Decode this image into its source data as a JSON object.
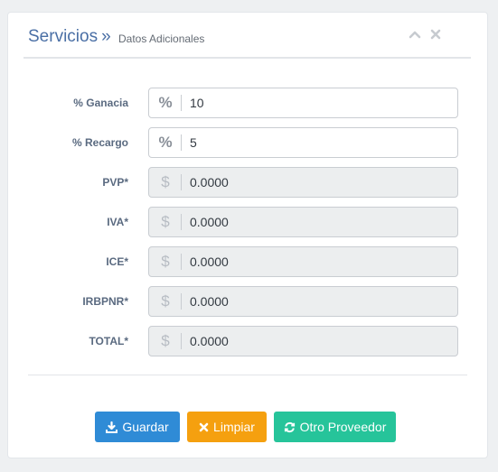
{
  "header": {
    "title": "Servicios",
    "title_sep": "»",
    "subtitle": "Datos Adicionales",
    "icons": [
      "chevron-up-icon",
      "close-icon"
    ]
  },
  "form": {
    "fields": [
      {
        "label": "% Ganacia",
        "addon": "%",
        "value": "10",
        "readonly": false
      },
      {
        "label": "% Recargo",
        "addon": "%",
        "value": "5",
        "readonly": false
      },
      {
        "label": "PVP*",
        "addon": "$",
        "value": "0.0000",
        "readonly": true
      },
      {
        "label": "IVA*",
        "addon": "$",
        "value": "0.0000",
        "readonly": true
      },
      {
        "label": "ICE*",
        "addon": "$",
        "value": "0.0000",
        "readonly": true
      },
      {
        "label": "IRBPNR*",
        "addon": "$",
        "value": "0.0000",
        "readonly": true
      },
      {
        "label": "TOTAL*",
        "addon": "$",
        "value": "0.0000",
        "readonly": true
      }
    ]
  },
  "buttons": {
    "save": "Guardar",
    "clear": "Limpiar",
    "other_provider": "Otro Proveedor"
  },
  "colors": {
    "save": "#2f8bd6",
    "clear": "#f5a00f",
    "other_provider": "#26c49a",
    "title": "#4a6fa5"
  }
}
